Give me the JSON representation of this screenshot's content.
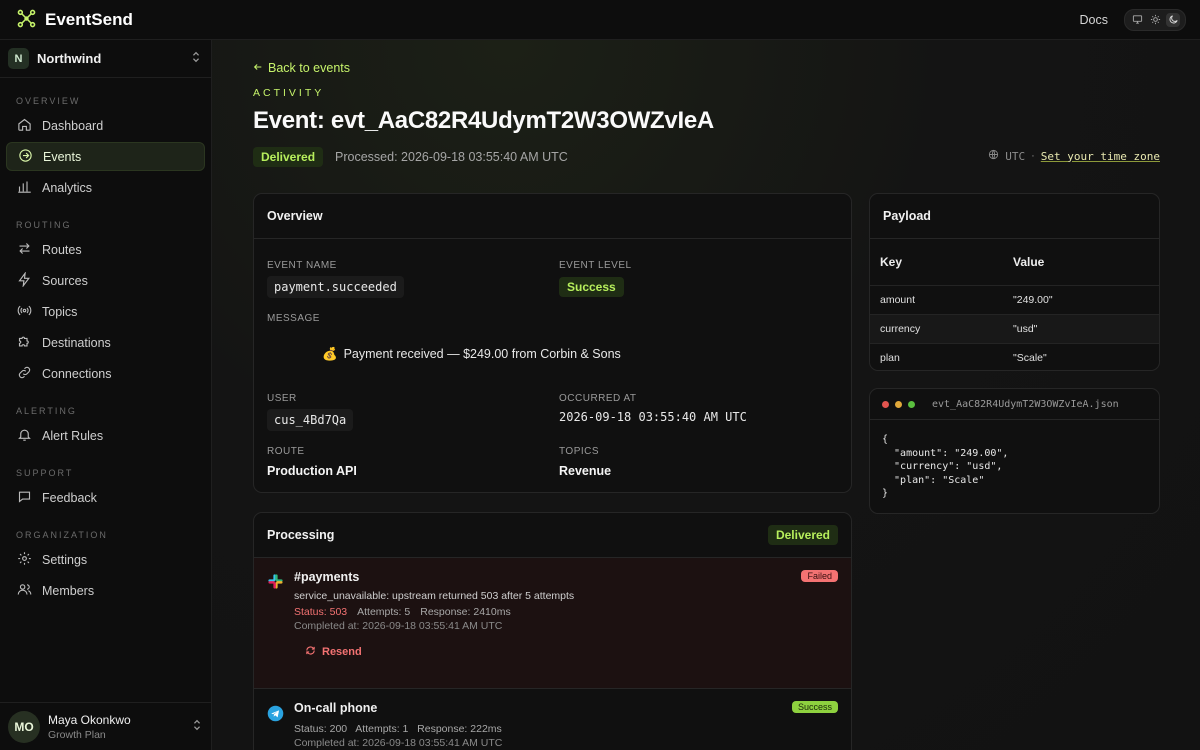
{
  "app": {
    "name": "EventSend",
    "docs_label": "Docs"
  },
  "theme": {
    "options": [
      "monitor-icon",
      "sun-icon",
      "moon-icon"
    ],
    "active": "moon-icon"
  },
  "workspace": {
    "initial": "N",
    "name": "Northwind"
  },
  "sidebar": {
    "sections": [
      {
        "label": "OVERVIEW",
        "items": [
          {
            "label": "Dashboard",
            "icon": "home-icon"
          },
          {
            "label": "Events",
            "icon": "arrow-circle-icon",
            "active": true
          },
          {
            "label": "Analytics",
            "icon": "bar-chart-icon"
          }
        ]
      },
      {
        "label": "ROUTING",
        "items": [
          {
            "label": "Routes",
            "icon": "swap-arrows-icon"
          },
          {
            "label": "Sources",
            "icon": "lightning-icon"
          },
          {
            "label": "Topics",
            "icon": "broadcast-icon"
          },
          {
            "label": "Destinations",
            "icon": "puzzle-icon"
          },
          {
            "label": "Connections",
            "icon": "link-icon"
          }
        ]
      },
      {
        "label": "ALERTING",
        "items": [
          {
            "label": "Alert Rules",
            "icon": "bell-icon"
          }
        ]
      },
      {
        "label": "SUPPORT",
        "items": [
          {
            "label": "Feedback",
            "icon": "chat-icon"
          }
        ]
      },
      {
        "label": "ORGANIZATION",
        "items": [
          {
            "label": "Settings",
            "icon": "gear-icon"
          },
          {
            "label": "Members",
            "icon": "users-icon"
          }
        ]
      }
    ]
  },
  "user": {
    "initials": "MO",
    "name": "Maya Okonkwo",
    "plan": "Growth Plan"
  },
  "page": {
    "back_label": "Back to events",
    "eyebrow": "ACTIVITY",
    "title": "Event: evt_AaC82R4UdymT2W3OWZvIeA",
    "status": "Delivered",
    "processed": "Processed: 2026-09-18 03:55:40 AM UTC",
    "timezone": "UTC",
    "timezone_sep": "·",
    "timezone_link": "Set your time zone"
  },
  "overview": {
    "title": "Overview",
    "event_name_label": "EVENT NAME",
    "event_name": "payment.succeeded",
    "event_level_label": "EVENT LEVEL",
    "event_level": "Success",
    "message_label": "MESSAGE",
    "message_emoji": "💰",
    "message": "Payment received — $249.00 from Corbin & Sons",
    "user_label": "USER",
    "user": "cus_4Bd7Qa",
    "occurred_label": "OCCURRED AT",
    "occurred": "2026-09-18 03:55:40 AM UTC",
    "route_label": "ROUTE",
    "route": "Production API",
    "topics_label": "TOPICS",
    "topics": "Revenue"
  },
  "processing": {
    "title": "Processing",
    "status": "Delivered",
    "rows": [
      {
        "icon": "slack-icon",
        "title": "#payments",
        "badge": "Failed",
        "message": "service_unavailable: upstream returned 503 after 5 attempts",
        "status": "Status: 503",
        "attempts": "Attempts: 5",
        "response": "Response: 2410ms",
        "completed": "Completed at: 2026-09-18 03:55:41 AM UTC",
        "action": "Resend"
      },
      {
        "icon": "telegram-icon",
        "title": "On-call phone",
        "badge": "Success",
        "meta": "Status: 200   Attempts: 1   Response: 222ms",
        "completed": "Completed at: 2026-09-18 03:55:41 AM UTC"
      }
    ]
  },
  "payload": {
    "title": "Payload",
    "key_header": "Key",
    "value_header": "Value",
    "rows": [
      {
        "key": "amount",
        "value": "\"249.00\""
      },
      {
        "key": "currency",
        "value": "\"usd\""
      },
      {
        "key": "plan",
        "value": "\"Scale\""
      }
    ]
  },
  "json_file": {
    "filename": "evt_AaC82R4UdymT2W3OWZvIeA.json",
    "content": "{\n  \"amount\": \"249.00\",\n  \"currency\": \"usd\",\n  \"plan\": \"Scale\"\n}"
  },
  "colors": {
    "accent": "#c6f36b",
    "success_bg": "#1f2d14",
    "failed_pill": "#f37272",
    "success_pill": "#8ed13f",
    "window_dots": [
      "#e2554f",
      "#e0a83a",
      "#5bbf3f"
    ]
  }
}
